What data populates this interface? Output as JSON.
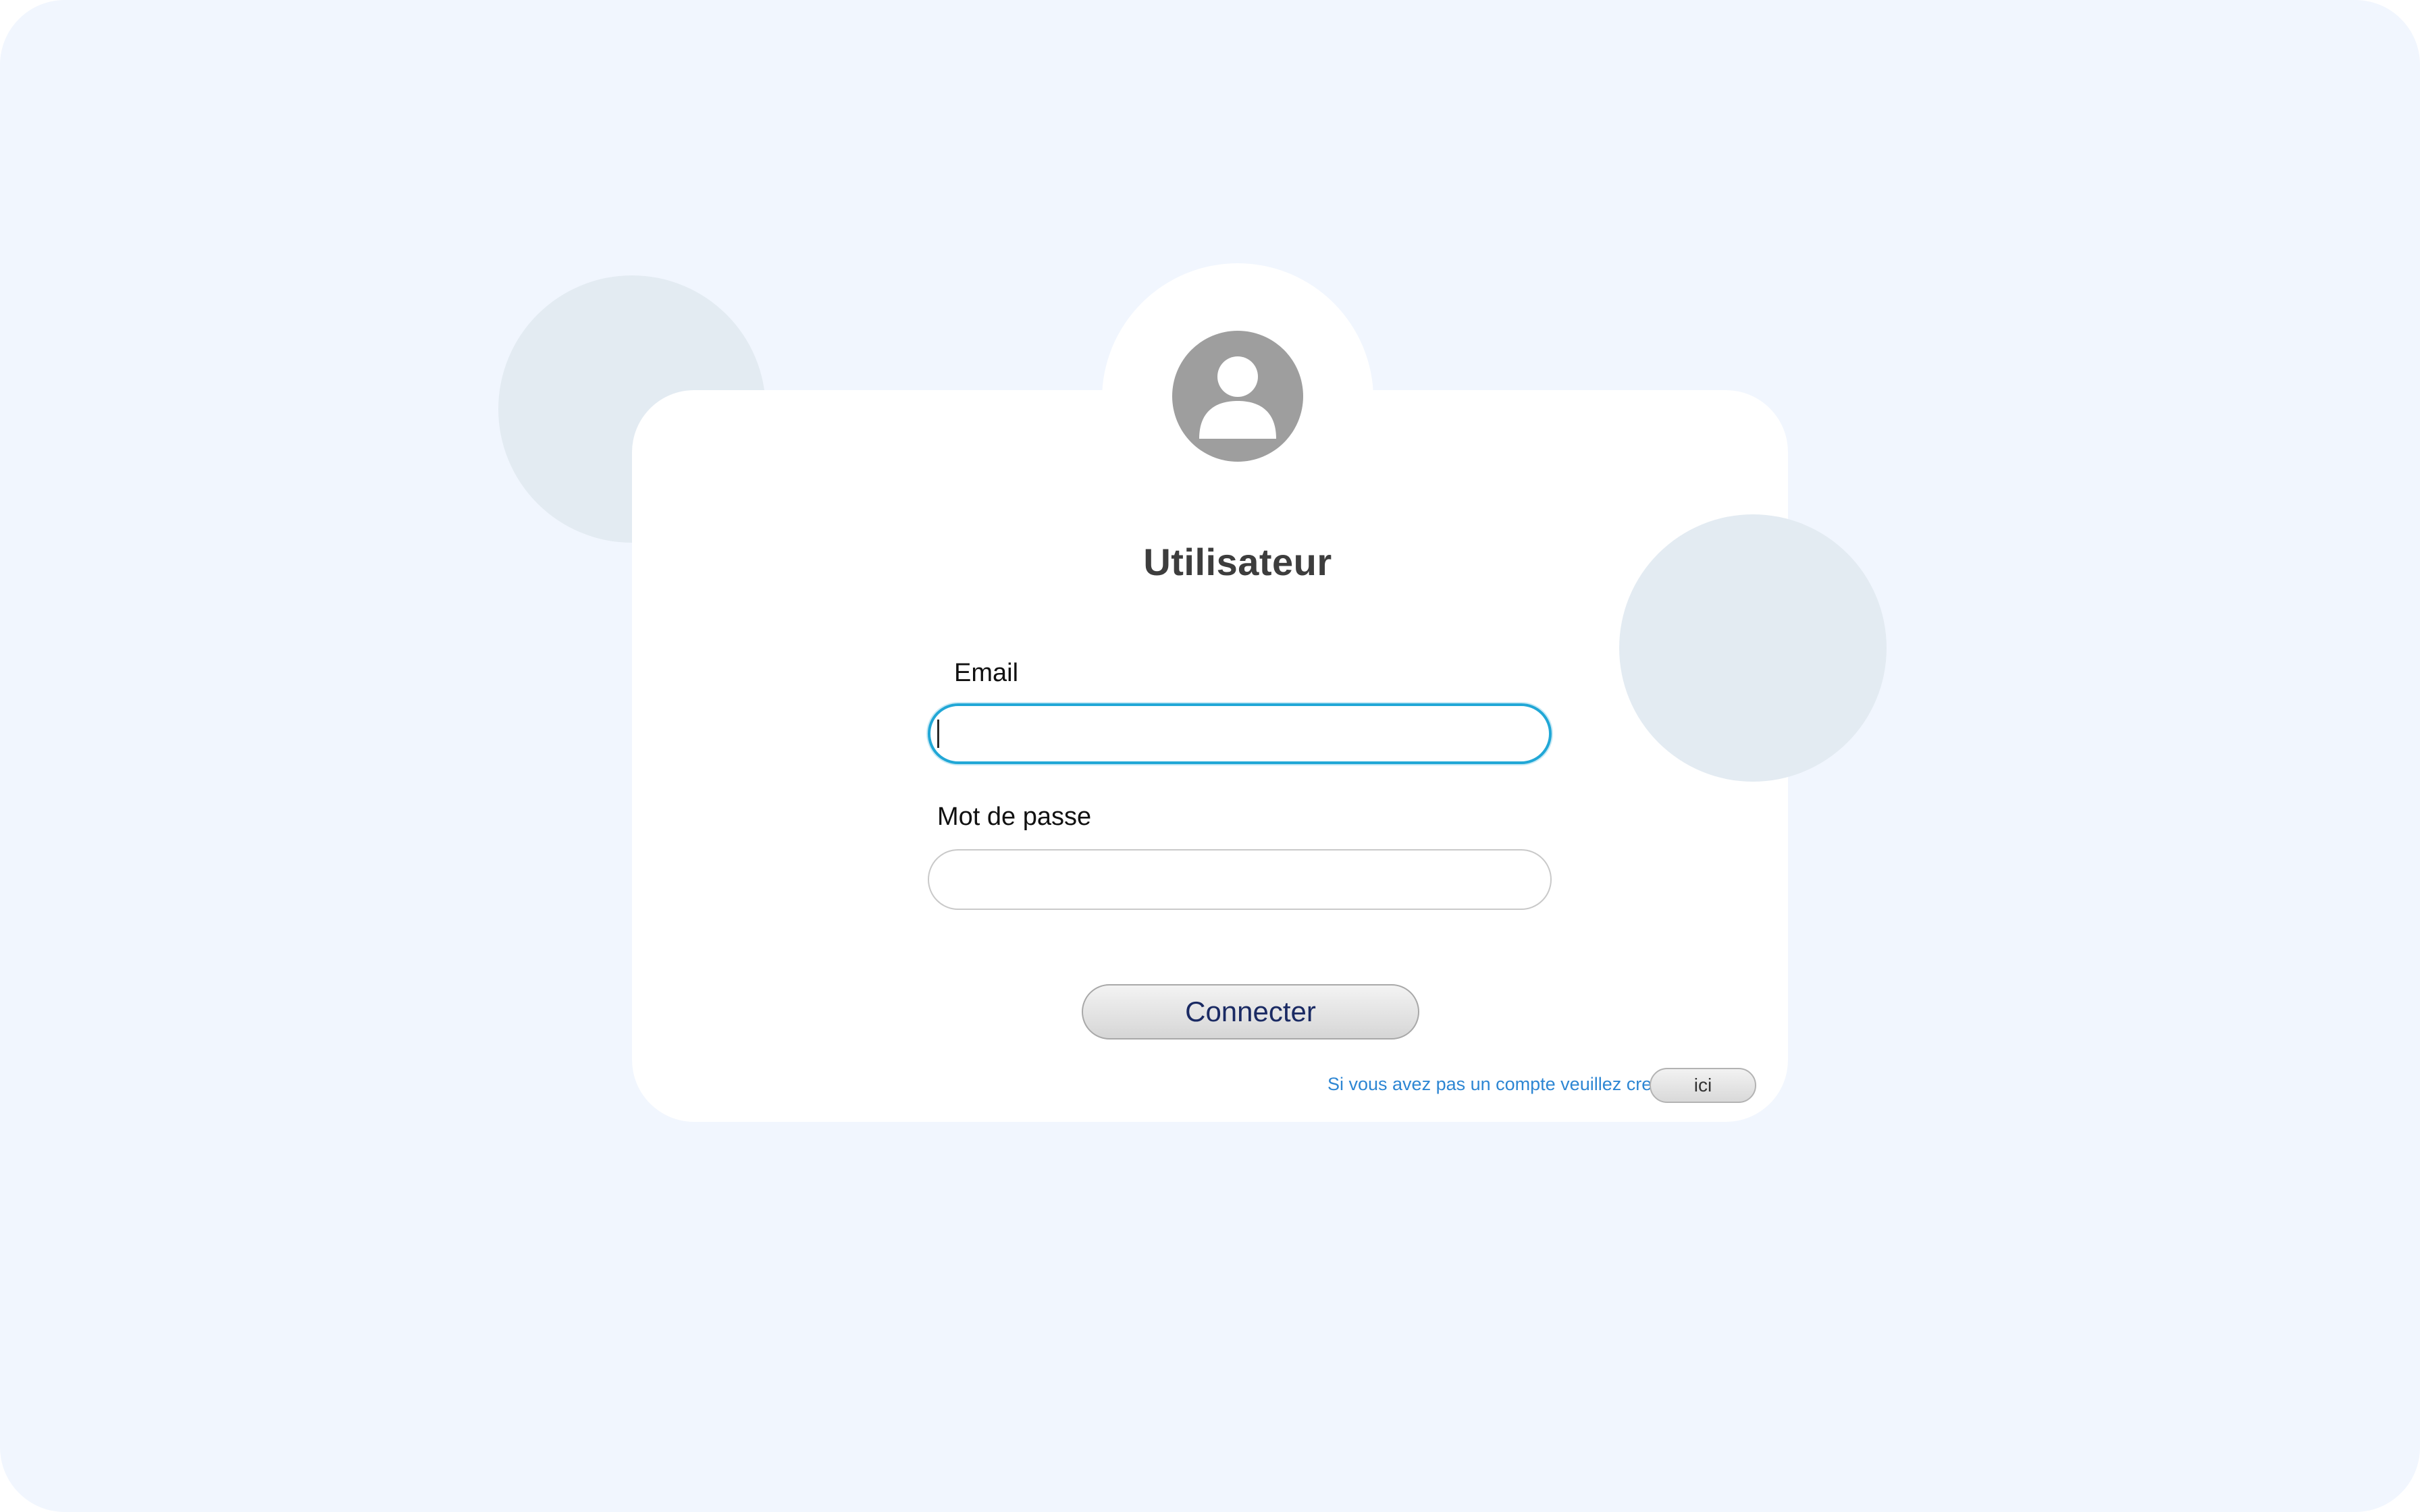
{
  "login": {
    "title": "Utilisateur",
    "email_label": "Email",
    "email_value": "",
    "password_label": "Mot de passe",
    "password_value": "",
    "connect_label": "Connecter",
    "signup_prompt": "Si vous avez pas un compte veuillez creer",
    "signup_link_label": "ici"
  },
  "icons": {
    "avatar": "user-avatar-icon"
  },
  "colors": {
    "page_background": "#f1f6fe",
    "card_background": "#ffffff",
    "decor_circle": "#e3ebf2",
    "avatar": "#9e9e9e",
    "focus_ring": "#21a7d6",
    "link_text": "#2d86d3",
    "button_text": "#1a2a63"
  }
}
